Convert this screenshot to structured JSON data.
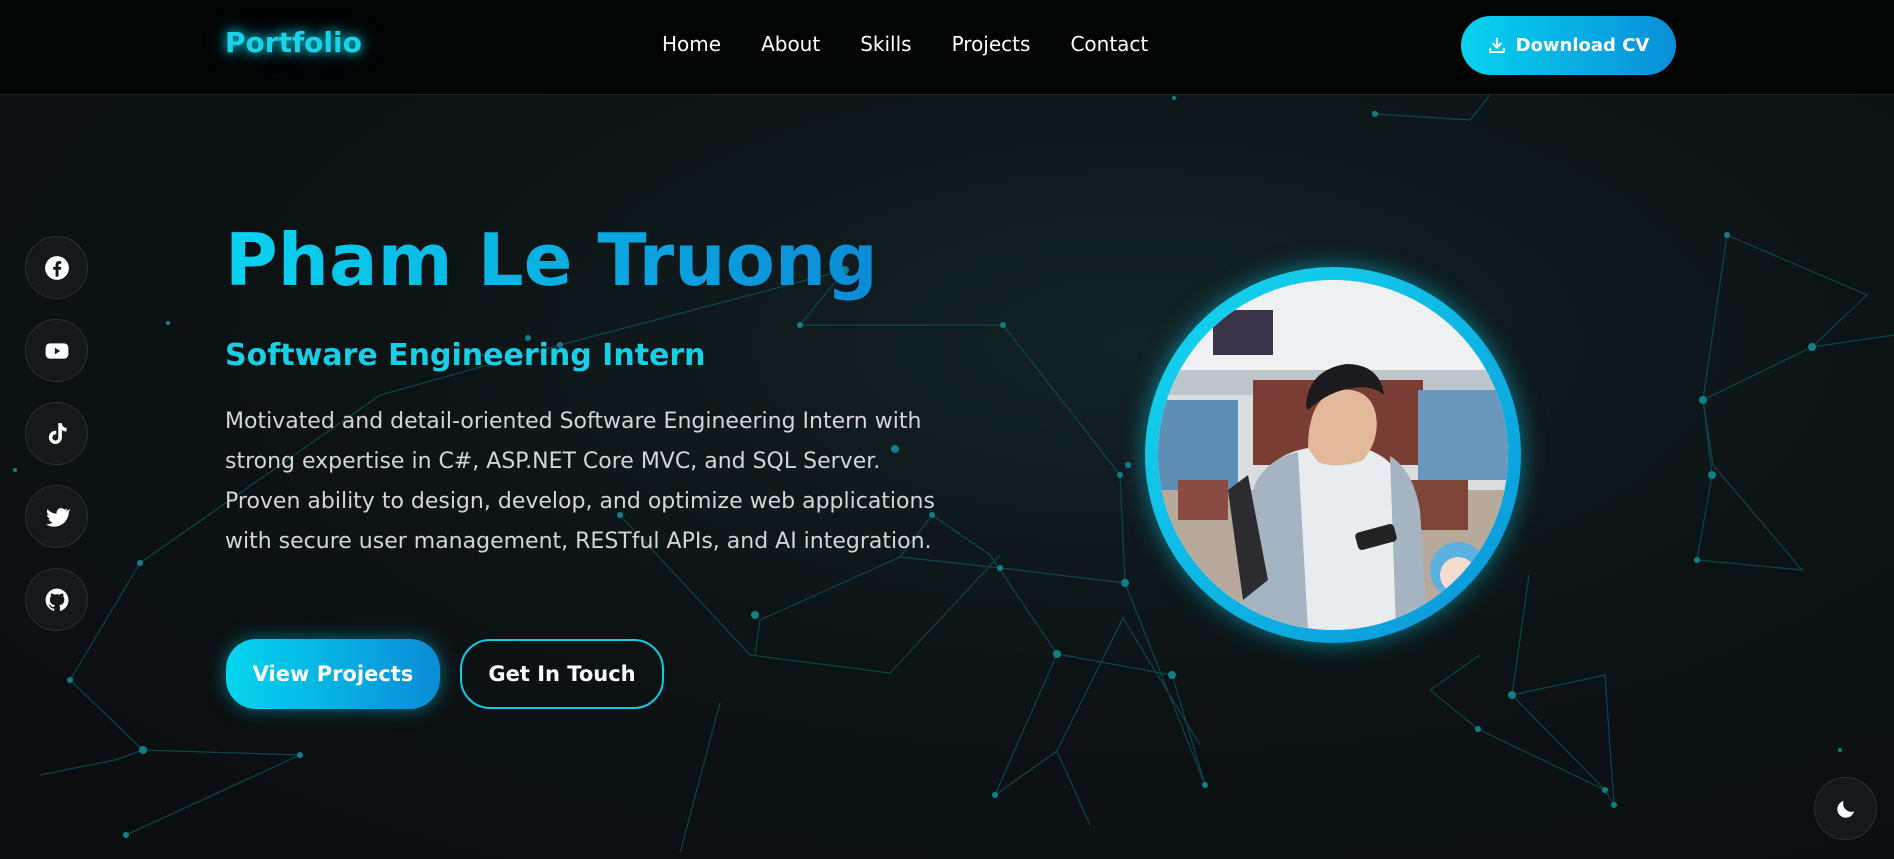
{
  "nav": {
    "logo": "Portfolio",
    "links": [
      "Home",
      "About",
      "Skills",
      "Projects",
      "Contact"
    ],
    "download_cv": "Download CV"
  },
  "social": [
    "facebook-icon",
    "youtube-icon",
    "tiktok-icon",
    "twitter-icon",
    "github-icon"
  ],
  "hero": {
    "name": "Pham Le Truong",
    "role": "Software Engineering Intern",
    "description": "Motivated and detail-oriented Software Engineering Intern with strong expertise in C#, ASP.NET Core MVC, and SQL Server. Proven ability to design, develop, and optimize web applications with secure user management, RESTful APIs, and AI integration.",
    "primary_button": "View Projects",
    "secondary_button": "Get In Touch"
  },
  "colors": {
    "accent": "#0ad3ee",
    "accent_dark": "#0b8bd6",
    "background": "#0e1012"
  },
  "theme_toggle_icon": "moon-icon"
}
